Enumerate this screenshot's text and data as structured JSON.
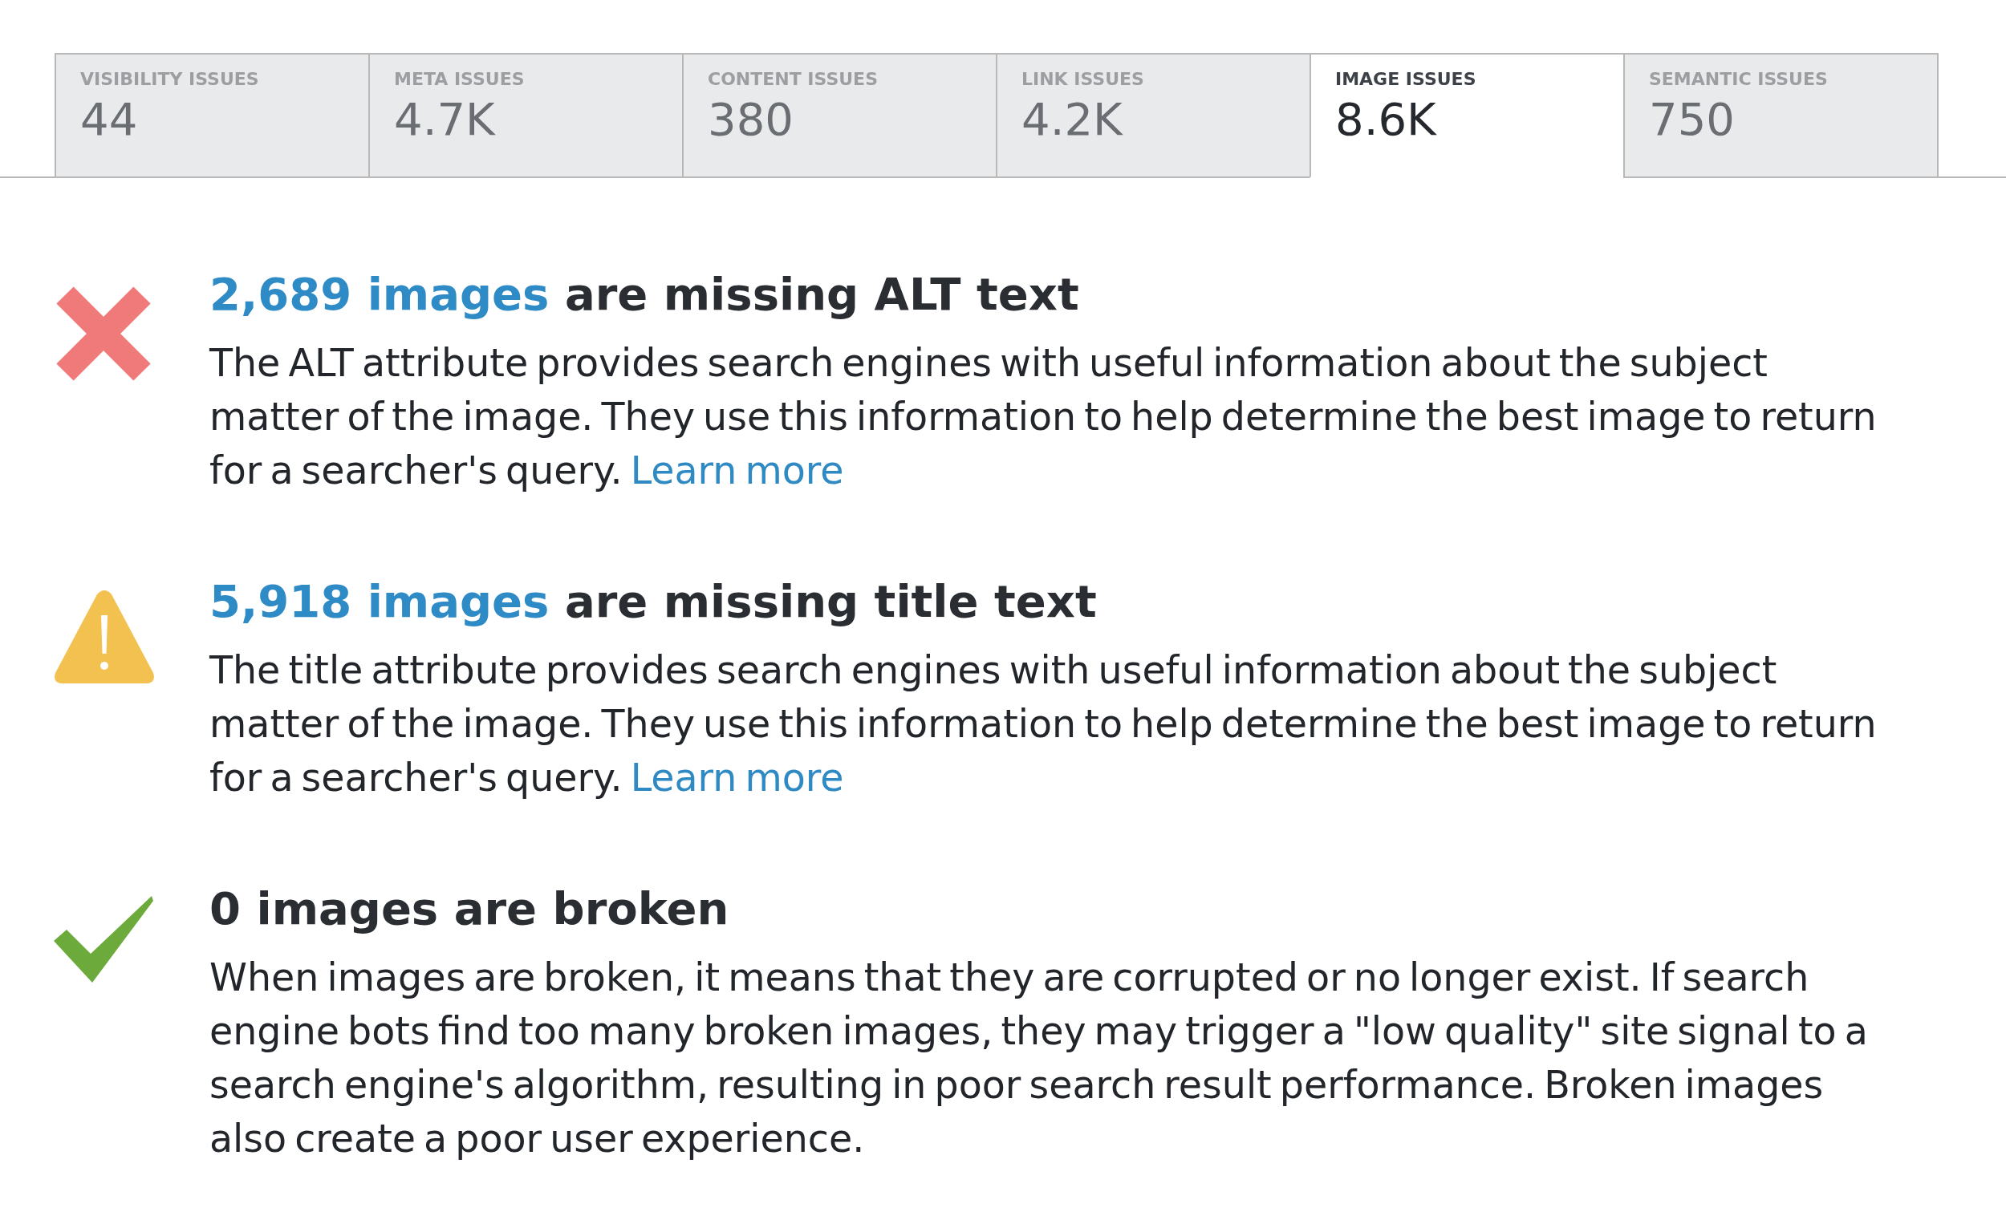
{
  "tabs": [
    {
      "label": "VISIBILITY ISSUES",
      "count": "44",
      "selected": false
    },
    {
      "label": "META ISSUES",
      "count": "4.7K",
      "selected": false
    },
    {
      "label": "CONTENT ISSUES",
      "count": "380",
      "selected": false
    },
    {
      "label": "LINK ISSUES",
      "count": "4.2K",
      "selected": false
    },
    {
      "label": "IMAGE ISSUES",
      "count": "8.6K",
      "selected": true
    },
    {
      "label": "SEMANTIC ISSUES",
      "count": "750",
      "selected": false
    }
  ],
  "issues": [
    {
      "kind": "error",
      "title_link": "2,689 images",
      "title": "are missing ALT text",
      "description": "The ALT attribute provides search engines with useful information about the subject matter of the image. They use this information to help determine the best image to return for a searcher's query.",
      "link": "Learn more"
    },
    {
      "kind": "warning",
      "title_link": "5,918 images",
      "title": "are missing title text",
      "description": "The title attribute provides search engines with useful information about the subject matter of the image. They use this information to help determine the best image to return for a searcher's query.",
      "link": "Learn more"
    },
    {
      "kind": "passed",
      "title": "0 images are broken",
      "description": "When images are broken, it means that they are corrupted or no longer exist. If search engine bots find too many broken images, they may trigger a \"low quality\" site signal to a search engine's algorithm, resulting in poor search result performance. Broken images also create a poor user experience."
    }
  ]
}
